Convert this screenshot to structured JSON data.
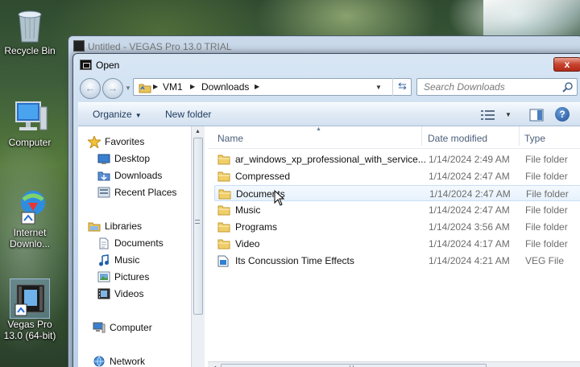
{
  "desktop": {
    "icons": [
      {
        "label": "Recycle Bin",
        "icon": "recycle-bin-icon"
      },
      {
        "label": "Computer",
        "icon": "computer-icon"
      },
      {
        "label": "Internet Downlo...",
        "icon": "internet-download-manager-icon"
      },
      {
        "label": "Vegas Pro 13.0 (64-bit)",
        "icon": "vegas-pro-icon"
      }
    ]
  },
  "back_window": {
    "title": "Untitled - VEGAS Pro 13.0 TRIAL"
  },
  "dialog": {
    "title": "Open",
    "close_label": "x",
    "address": {
      "segments": [
        "VM1",
        "Downloads"
      ]
    },
    "search": {
      "placeholder": "Search Downloads"
    },
    "toolbar": {
      "organize": "Organize",
      "new_folder": "New folder",
      "help": "?"
    },
    "nav": {
      "favorites_header": "Favorites",
      "favorites": [
        "Desktop",
        "Downloads",
        "Recent Places"
      ],
      "libraries_header": "Libraries",
      "libraries": [
        "Documents",
        "Music",
        "Pictures",
        "Videos"
      ],
      "computer": "Computer",
      "network": "Network"
    },
    "columns": {
      "name": "Name",
      "date": "Date modified",
      "type": "Type"
    },
    "files": [
      {
        "name": "ar_windows_xp_professional_with_service...",
        "date": "1/14/2024 2:49 AM",
        "type": "File folder",
        "icon": "folder-icon"
      },
      {
        "name": "Compressed",
        "date": "1/14/2024 2:47 AM",
        "type": "File folder",
        "icon": "folder-icon"
      },
      {
        "name": "Documents",
        "date": "1/14/2024 2:47 AM",
        "type": "File folder",
        "icon": "folder-icon"
      },
      {
        "name": "Music",
        "date": "1/14/2024 2:47 AM",
        "type": "File folder",
        "icon": "folder-icon"
      },
      {
        "name": "Programs",
        "date": "1/14/2024 3:56 AM",
        "type": "File folder",
        "icon": "folder-icon"
      },
      {
        "name": "Video",
        "date": "1/14/2024 4:17 AM",
        "type": "File folder",
        "icon": "folder-icon"
      },
      {
        "name": "Its Concussion Time Effects",
        "date": "1/14/2024 4:21 AM",
        "type": "VEG File",
        "icon": "veg-file-icon"
      }
    ]
  }
}
